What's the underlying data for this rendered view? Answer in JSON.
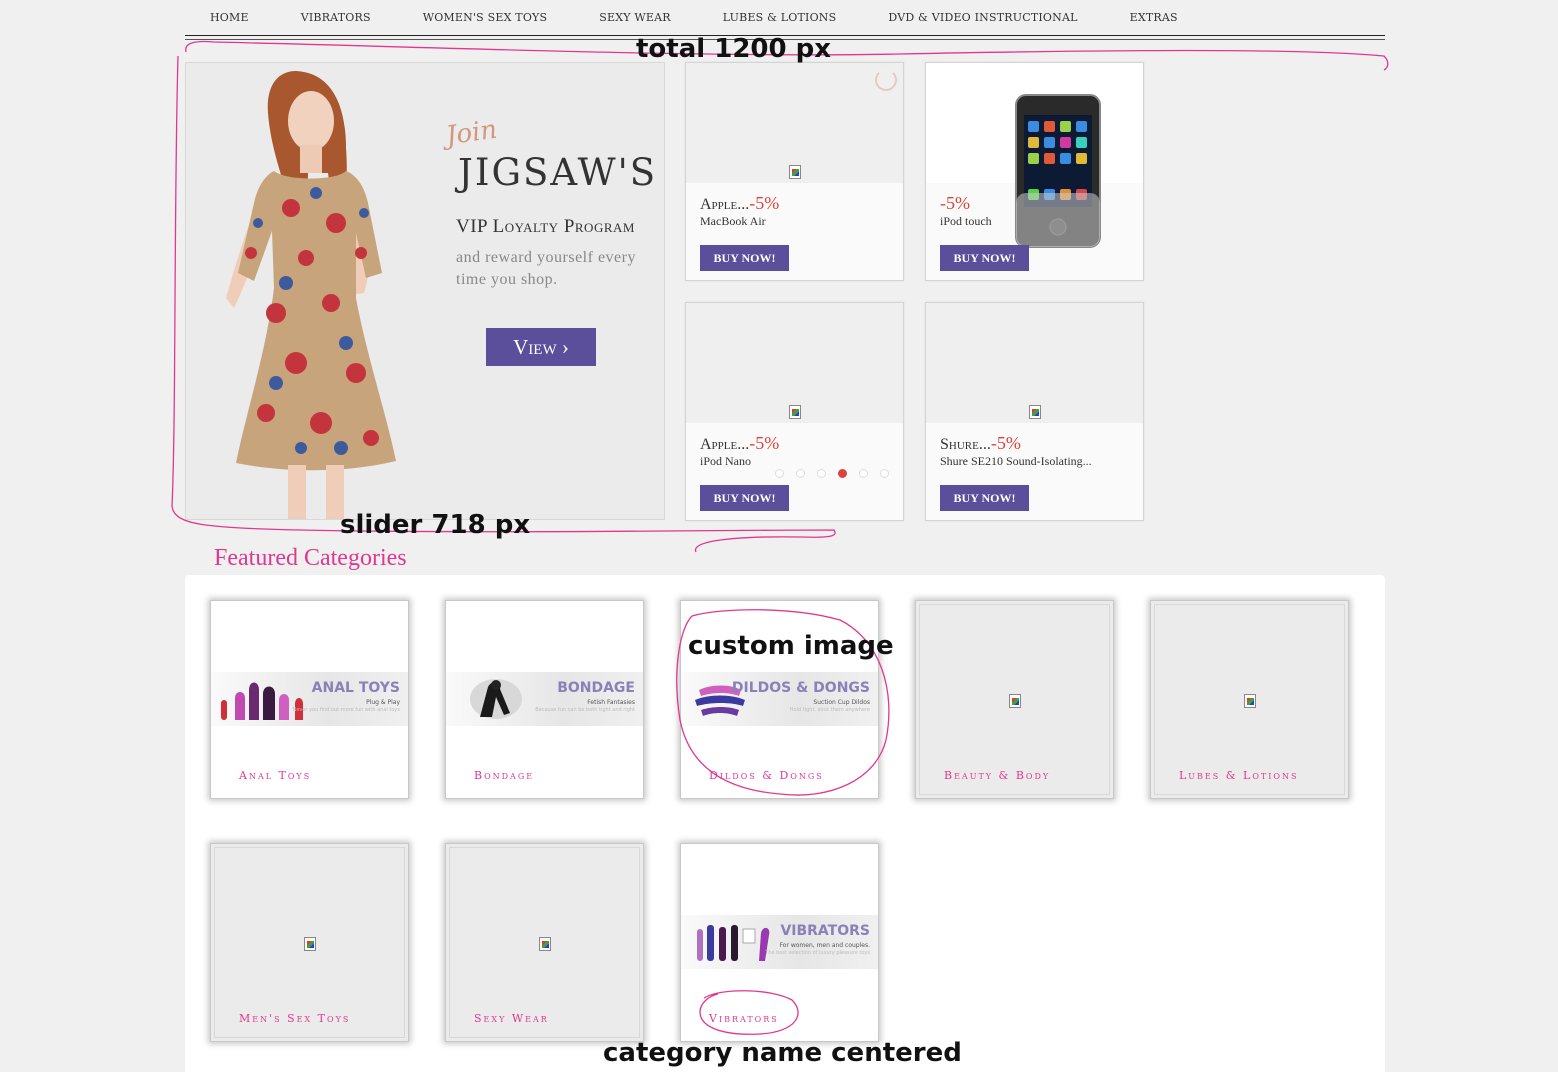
{
  "nav": {
    "items": [
      "HOME",
      "VIBRATORS",
      "WOMEN'S SEX TOYS",
      "SEXY WEAR",
      "LUBES & LOTIONS",
      "DVD & VIDEO INSTRUCTIONAL",
      "EXTRAS"
    ]
  },
  "annotations": {
    "total": "total 1200 px",
    "slider": "slider 718 px",
    "custom_image": "custom image",
    "category_centered": "category name centered",
    "color": "#e0388e"
  },
  "slider": {
    "join": "Join",
    "title": "JIGSAW'S",
    "subtitle": "VIP Loyalty Program",
    "text": "and reward yourself every time you shop.",
    "button": "View ›",
    "active_dot": 4,
    "dot_count": 6
  },
  "products": [
    {
      "brand": "Apple...",
      "discount": "-5%",
      "model": "MacBook Air",
      "button": "BUY NOW!"
    },
    {
      "brand": "",
      "discount": "-5%",
      "model": "iPod touch",
      "button": "BUY NOW!",
      "image": "ipod-touch-image"
    },
    {
      "brand": "Apple...",
      "discount": "-5%",
      "model": "iPod Nano",
      "button": "BUY NOW!"
    },
    {
      "brand": "Shure...",
      "discount": "-5%",
      "model": "Shure SE210 Sound-Isolating...",
      "button": "BUY NOW!"
    }
  ],
  "featured": {
    "title": "Featured Categories",
    "categories": [
      {
        "name": "Anal Toys",
        "banner_title": "ANAL TOYS",
        "banner_sub": "Plug & Play",
        "banner_fine": "Never you find out more fun with anal toys",
        "has_image": true
      },
      {
        "name": "Bondage",
        "banner_title": "BONDAGE",
        "banner_sub": "Fetish Fantasies",
        "banner_fine": "Because fun can be both tight and right",
        "has_image": true
      },
      {
        "name": "Dildos & Dongs",
        "banner_title": "DILDOS & DONGS",
        "banner_sub": "Suction Cup Dildos",
        "banner_fine": "Hold tight, stick them anywhere",
        "has_image": true
      },
      {
        "name": "Beauty & Body",
        "has_image": false
      },
      {
        "name": "Lubes & Lotions",
        "has_image": false
      },
      {
        "name": "Men's Sex Toys",
        "has_image": false
      },
      {
        "name": "Sexy Wear",
        "has_image": false
      },
      {
        "name": "Vibrators",
        "banner_title": "VIBRATORS",
        "banner_sub": "For women, men and couples.",
        "banner_fine": "The best selection of luxury pleasure toys",
        "has_image": true
      }
    ]
  },
  "colors": {
    "accent": "#e0388e",
    "button": "#5b4f9b",
    "discount": "#d9443b"
  }
}
